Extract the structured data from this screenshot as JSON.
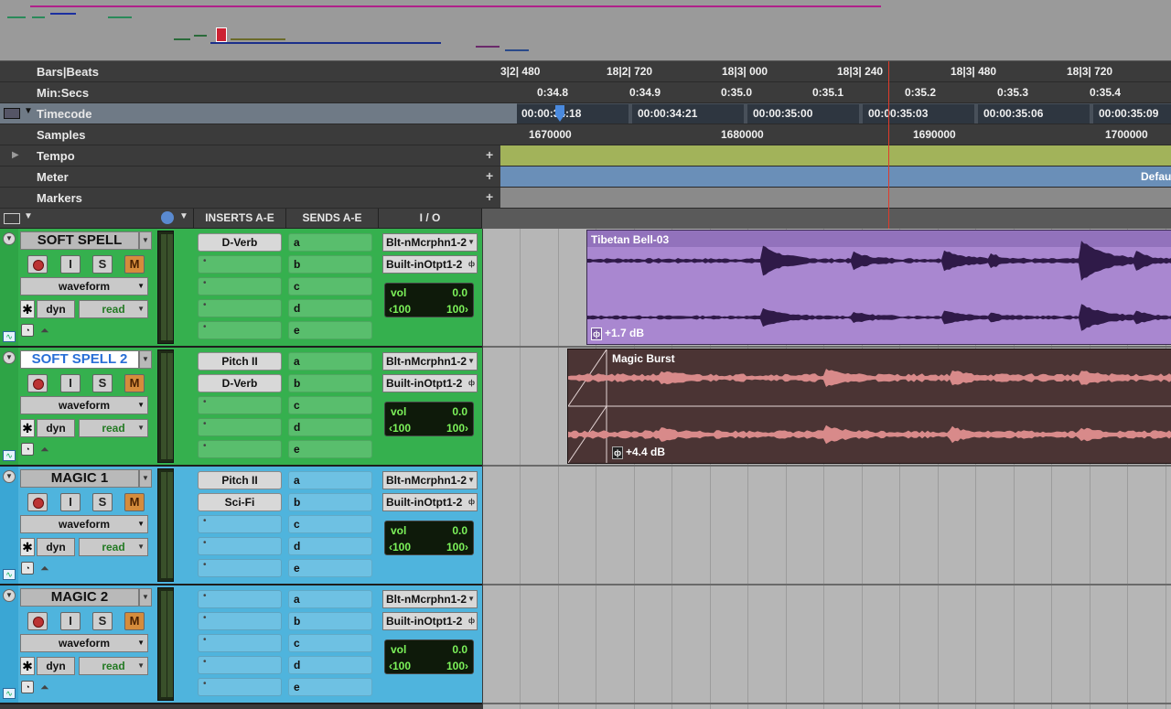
{
  "rulers": {
    "bars_beats": {
      "label": "Bars|Beats",
      "ticks": [
        "3|2| 480",
        "18|2| 720",
        "18|3| 000",
        "18|3| 240",
        "18|3| 480",
        "18|3| 720"
      ]
    },
    "min_secs": {
      "label": "Min:Secs",
      "ticks": [
        "0:34.8",
        "0:34.9",
        "0:35.0",
        "0:35.1",
        "0:35.2",
        "0:35.3",
        "0:35.4"
      ]
    },
    "timecode": {
      "label": "Timecode",
      "ticks": [
        "00:00:34:18",
        "00:00:34:21",
        "00:00:35:00",
        "00:00:35:03",
        "00:00:35:06",
        "00:00:35:09"
      ]
    },
    "samples": {
      "label": "Samples",
      "ticks": [
        "1670000",
        "1680000",
        "1690000",
        "1700000"
      ]
    },
    "tempo": {
      "label": "Tempo"
    },
    "meter": {
      "label": "Meter",
      "value": "Defau"
    },
    "markers": {
      "label": "Markers"
    }
  },
  "columns": {
    "inserts": "INSERTS A-E",
    "sends": "SENDS A-E",
    "io": "I / O"
  },
  "colors": {
    "green_track": "#35b04e",
    "blue_track": "#4fb4dd",
    "tibetan_clip": "#a987d0",
    "magic_clip": "#4b3434",
    "cursor": "#e03a2a"
  },
  "tracks": [
    {
      "name": "SOFT SPELL",
      "selected": false,
      "color": "green",
      "view": "waveform",
      "dyn": "dyn",
      "automation": "read",
      "inserts": [
        "D-Verb",
        "",
        "",
        "",
        ""
      ],
      "sends": [
        "a",
        "b",
        "c",
        "d",
        "e"
      ],
      "input": "Blt-nMcrphn1-2",
      "output": "Built-inOtpt1-2",
      "vol_label": "vol",
      "vol": "0.0",
      "pan_l": "‹100",
      "pan_r": "100›"
    },
    {
      "name": "SOFT SPELL 2",
      "selected": true,
      "color": "green",
      "view": "waveform",
      "dyn": "dyn",
      "automation": "read",
      "inserts": [
        "Pitch II",
        "D-Verb",
        "",
        "",
        ""
      ],
      "sends": [
        "a",
        "b",
        "c",
        "d",
        "e"
      ],
      "input": "Blt-nMcrphn1-2",
      "output": "Built-inOtpt1-2",
      "vol_label": "vol",
      "vol": "0.0",
      "pan_l": "‹100",
      "pan_r": "100›"
    },
    {
      "name": "MAGIC 1",
      "selected": false,
      "color": "blue",
      "view": "waveform",
      "dyn": "dyn",
      "automation": "read",
      "inserts": [
        "Pitch II",
        "Sci-Fi",
        "",
        "",
        ""
      ],
      "sends": [
        "a",
        "b",
        "c",
        "d",
        "e"
      ],
      "input": "Blt-nMcrphn1-2",
      "output": "Built-inOtpt1-2",
      "vol_label": "vol",
      "vol": "0.0",
      "pan_l": "‹100",
      "pan_r": "100›"
    },
    {
      "name": "MAGIC 2",
      "selected": false,
      "color": "blue",
      "view": "waveform",
      "dyn": "dyn",
      "automation": "read",
      "inserts": [
        "",
        "",
        "",
        "",
        ""
      ],
      "sends": [
        "a",
        "b",
        "c",
        "d",
        "e"
      ],
      "input": "Blt-nMcrphn1-2",
      "output": "Built-inOtpt1-2",
      "vol_label": "vol",
      "vol": "0.0",
      "pan_l": "‹100",
      "pan_r": "100›"
    }
  ],
  "track_buttons": {
    "input": "I",
    "solo": "S",
    "mute": "M"
  },
  "clips": [
    {
      "name": "Tibetan Bell-03",
      "gain": "+1.7 dB"
    },
    {
      "name": "Magic Burst",
      "gain": "+4.4 dB"
    }
  ]
}
